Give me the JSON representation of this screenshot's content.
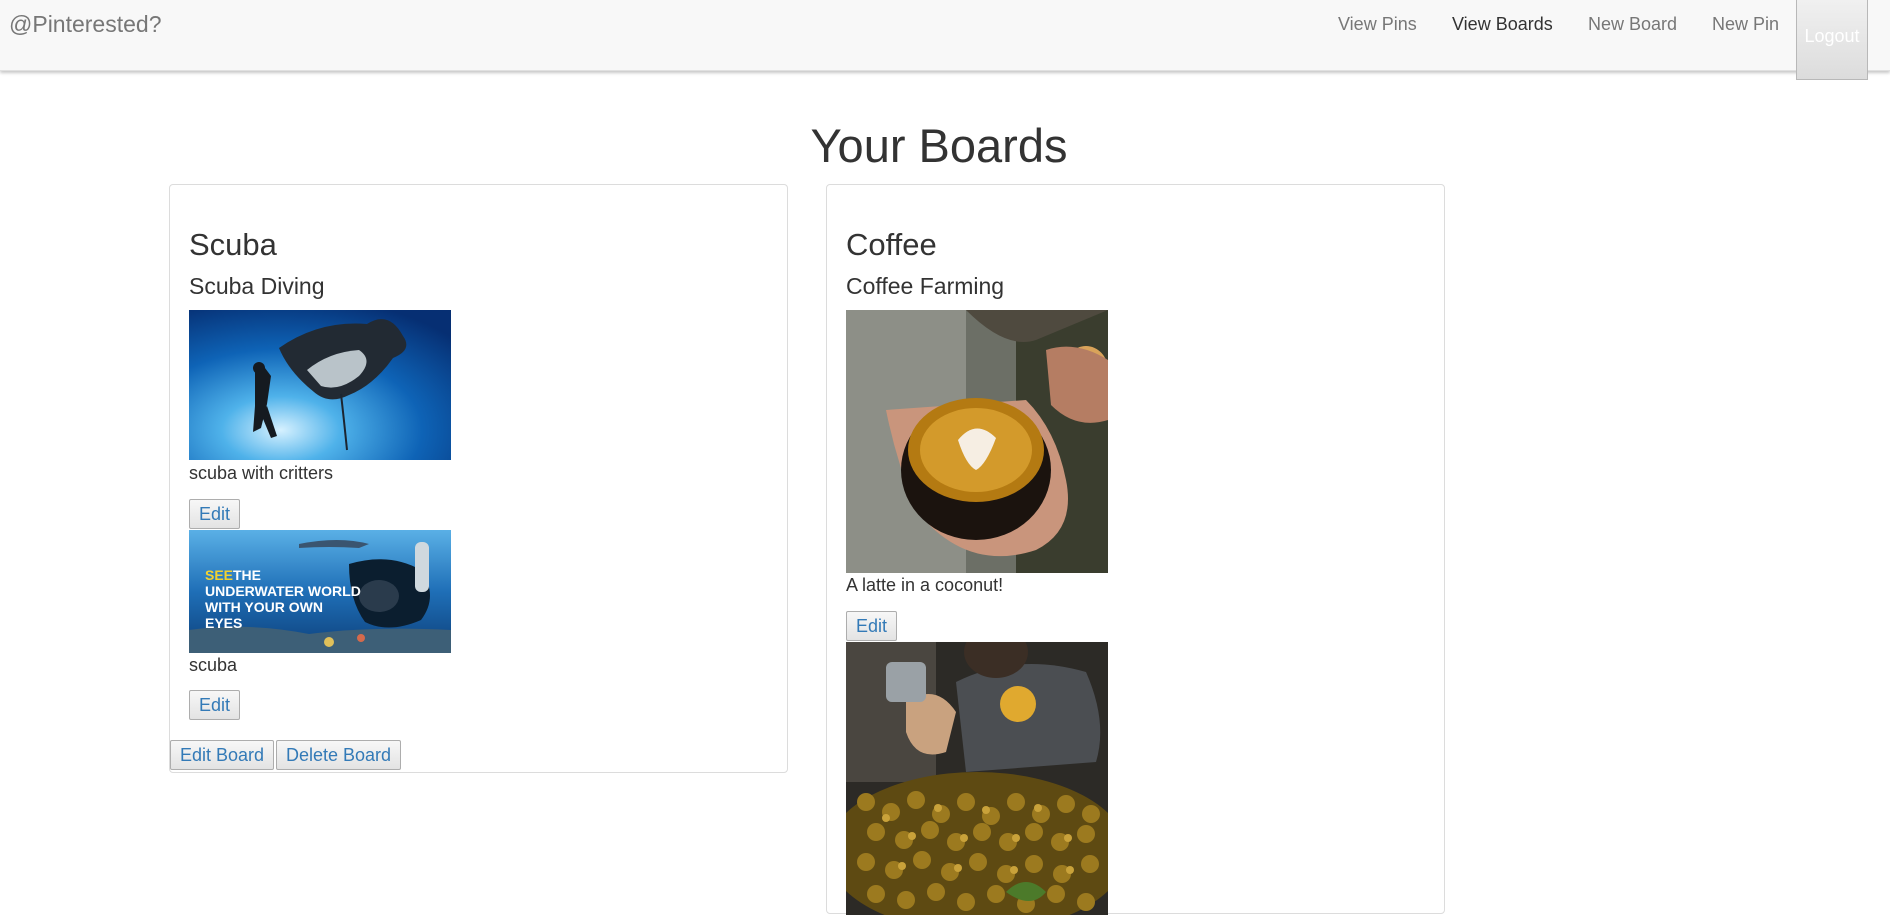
{
  "navbar": {
    "brand": "@Pinterested?",
    "links": [
      {
        "label": "View Pins"
      },
      {
        "label": "View Boards"
      },
      {
        "label": "New Board"
      },
      {
        "label": "New Pin"
      }
    ],
    "logout": "Logout"
  },
  "page": {
    "title": "Your Boards"
  },
  "boards": [
    {
      "title": "Scuba",
      "description": "Scuba Diving",
      "pins": [
        {
          "caption": "scuba with critters",
          "edit_label": "Edit"
        },
        {
          "caption": "scuba",
          "edit_label": "Edit",
          "image_text": [
            "SEE",
            "THE",
            "UNDERWATER WORLD",
            "WITH YOUR OWN",
            "EYES"
          ]
        }
      ],
      "edit_board_label": "Edit Board",
      "delete_board_label": "Delete Board"
    },
    {
      "title": "Coffee",
      "description": "Coffee Farming",
      "pins": [
        {
          "caption": "A latte in a coconut!",
          "edit_label": "Edit"
        }
      ]
    }
  ]
}
